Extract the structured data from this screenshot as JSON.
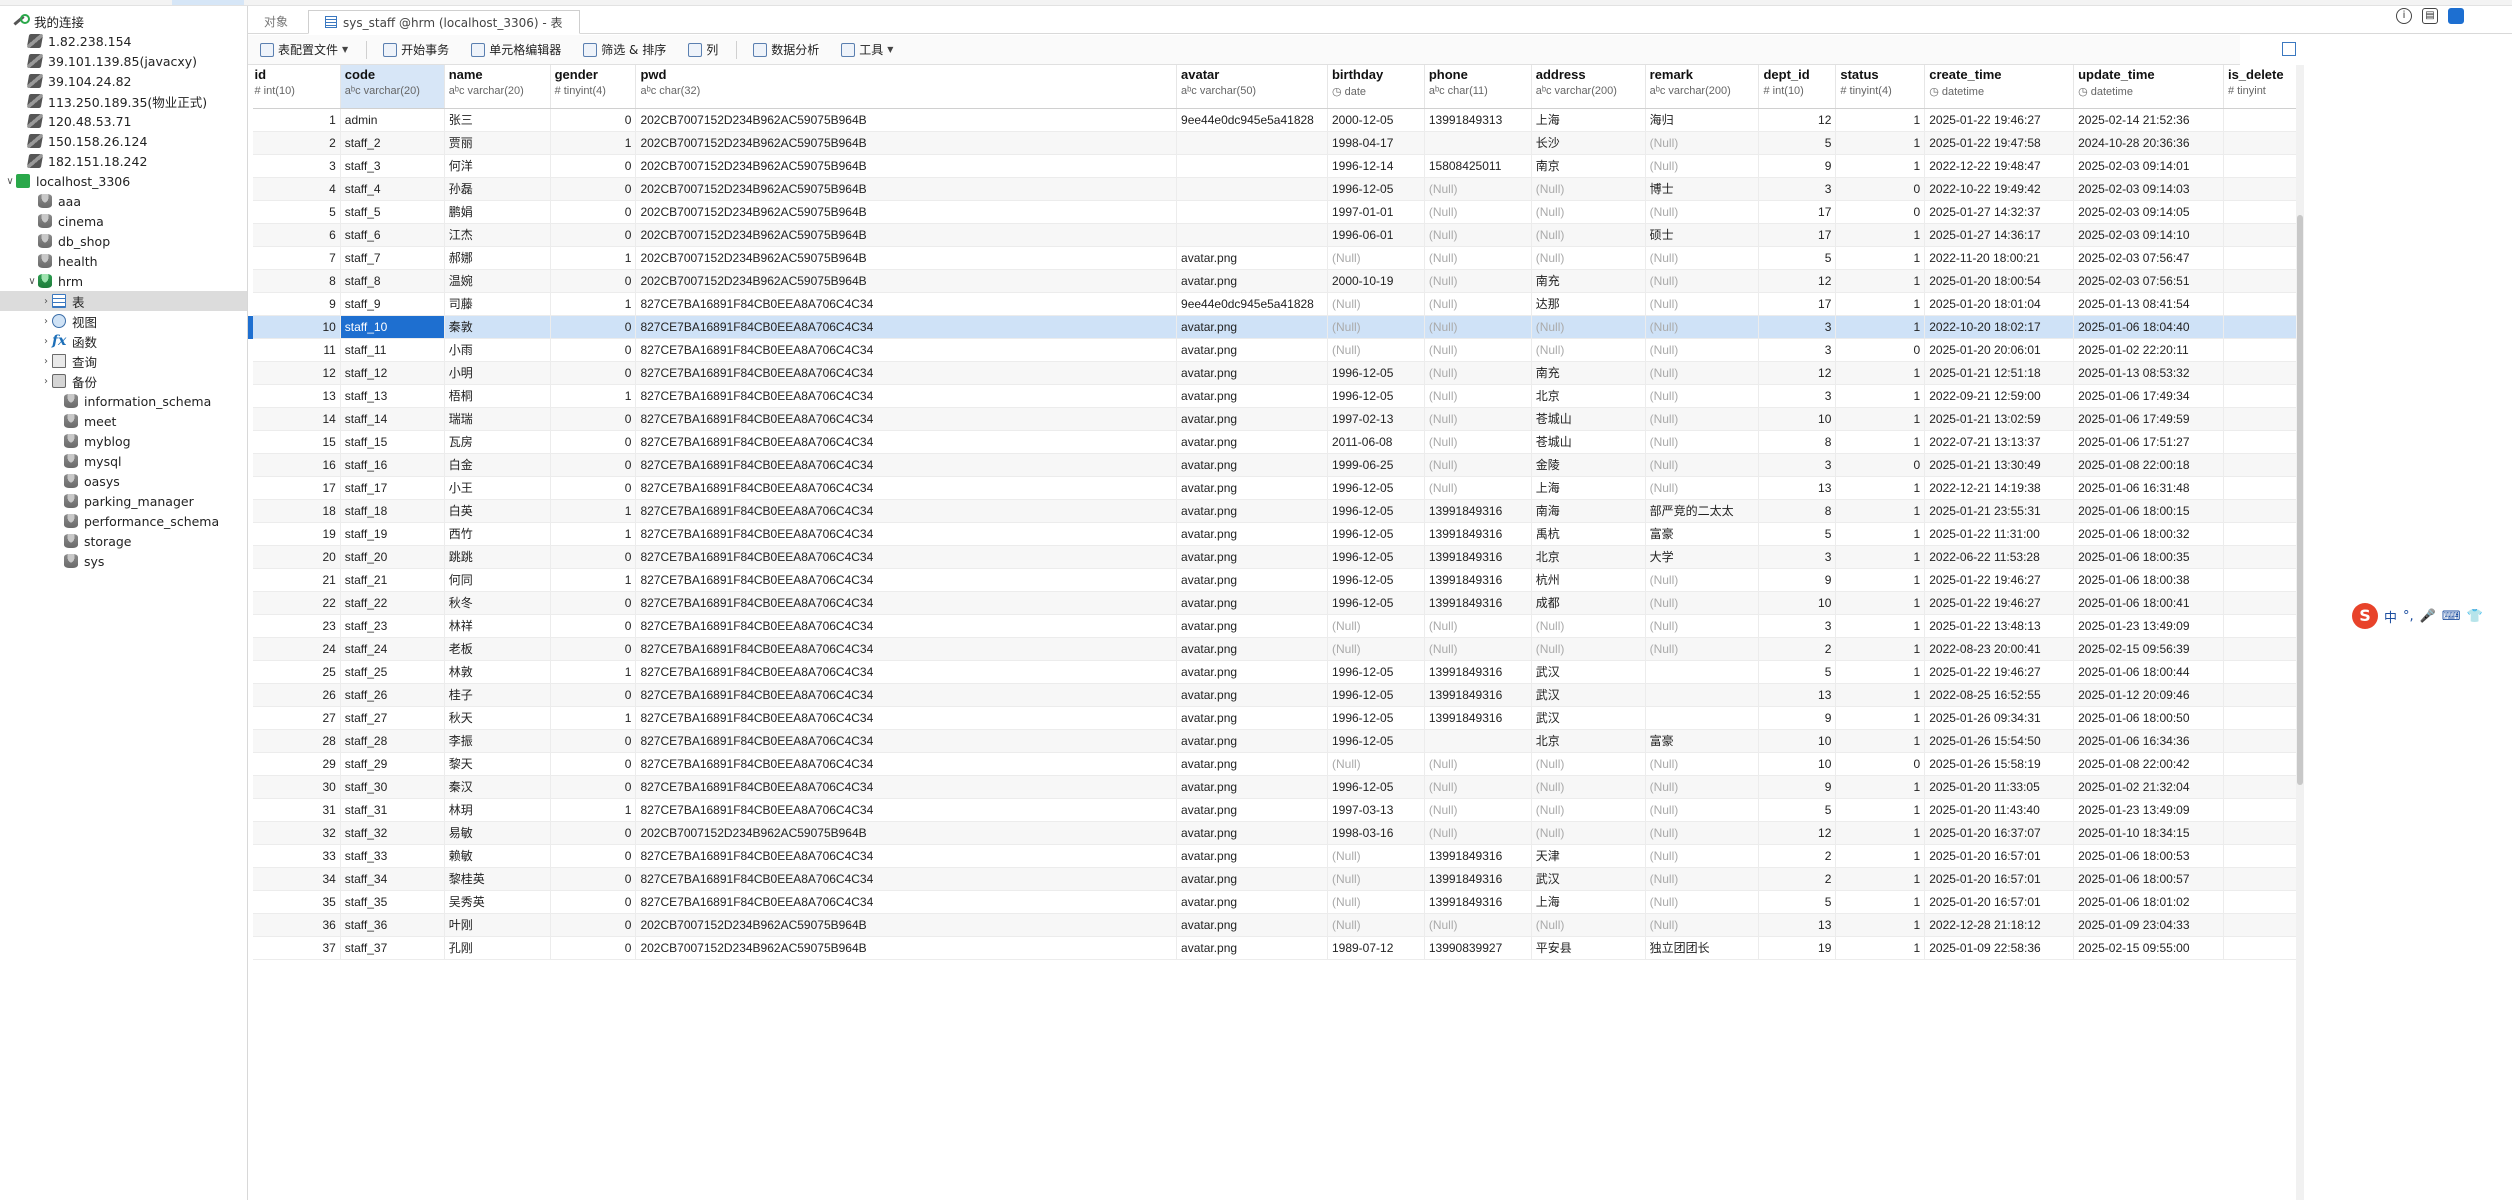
{
  "sidebar": {
    "root": "我的连接",
    "connections": [
      "1.82.238.154",
      "39.101.139.85(javacxy)",
      "39.104.24.82",
      "113.250.189.35(物业正式)",
      "120.48.53.71",
      "150.158.26.124",
      "182.151.18.242"
    ],
    "localhost": "localhost_3306",
    "dbs_before": [
      "aaa",
      "cinema",
      "db_shop",
      "health"
    ],
    "hrm": "hrm",
    "hrm_children": [
      {
        "label": "表",
        "icon": "table-icon",
        "selected": true
      },
      {
        "label": "视图",
        "icon": "view-icon"
      },
      {
        "label": "函数",
        "icon": "function-icon"
      },
      {
        "label": "查询",
        "icon": "query-icon"
      },
      {
        "label": "备份",
        "icon": "backup-icon"
      }
    ],
    "dbs_after": [
      "information_schema",
      "meet",
      "myblog",
      "mysql",
      "oasys",
      "parking_manager",
      "performance_schema",
      "storage",
      "sys"
    ]
  },
  "tabs": {
    "objects": "对象",
    "active": "sys_staff @hrm (localhost_3306) - 表"
  },
  "toolbar": {
    "config": "表配置文件",
    "begin_tx": "开始事务",
    "cell_editor": "单元格编辑器",
    "filter_sort": "筛选 & 排序",
    "columns": "列",
    "analysis": "数据分析",
    "tools": "工具"
  },
  "columns": [
    {
      "name": "id",
      "type": "int(10)",
      "icon": "#"
    },
    {
      "name": "code",
      "type": "varchar(20)",
      "icon": "aᵇc"
    },
    {
      "name": "name",
      "type": "varchar(20)",
      "icon": "aᵇc"
    },
    {
      "name": "gender",
      "type": "tinyint(4)",
      "icon": "#"
    },
    {
      "name": "pwd",
      "type": "char(32)",
      "icon": "aᵇc"
    },
    {
      "name": "avatar",
      "type": "varchar(50)",
      "icon": "aᵇc"
    },
    {
      "name": "birthday",
      "type": "date",
      "icon": "◷"
    },
    {
      "name": "phone",
      "type": "char(11)",
      "icon": "aᵇc"
    },
    {
      "name": "address",
      "type": "varchar(200)",
      "icon": "aᵇc"
    },
    {
      "name": "remark",
      "type": "varchar(200)",
      "icon": "aᵇc"
    },
    {
      "name": "dept_id",
      "type": "int(10)",
      "icon": "#"
    },
    {
      "name": "status",
      "type": "tinyint(4)",
      "icon": "#"
    },
    {
      "name": "create_time",
      "type": "datetime",
      "icon": "◷"
    },
    {
      "name": "update_time",
      "type": "datetime",
      "icon": "◷"
    },
    {
      "name": "is_delete",
      "type": "tinyint",
      "icon": "#"
    }
  ],
  "rows": [
    [
      "1",
      "admin",
      "张三",
      "0",
      "202CB7007152D234B962AC59075B964B",
      "9ee44e0dc945e5a41828",
      "2000-12-05",
      "13991849313",
      "上海",
      "海归",
      "12",
      "1",
      "2025-01-22 19:46:27",
      "2025-02-14 21:52:36"
    ],
    [
      "2",
      "staff_2",
      "贾丽",
      "1",
      "202CB7007152D234B962AC59075B964B",
      "",
      "1998-04-17",
      "",
      "长沙",
      "(Null)",
      "5",
      "1",
      "2025-01-22 19:47:58",
      "2024-10-28 20:36:36"
    ],
    [
      "3",
      "staff_3",
      "何洋",
      "0",
      "202CB7007152D234B962AC59075B964B",
      "",
      "1996-12-14",
      "15808425011",
      "南京",
      "(Null)",
      "9",
      "1",
      "2022-12-22 19:48:47",
      "2025-02-03 09:14:01"
    ],
    [
      "4",
      "staff_4",
      "孙磊",
      "0",
      "202CB7007152D234B962AC59075B964B",
      "",
      "1996-12-05",
      "(Null)",
      "(Null)",
      "博士",
      "3",
      "0",
      "2022-10-22 19:49:42",
      "2025-02-03 09:14:03"
    ],
    [
      "5",
      "staff_5",
      "鹏娟",
      "0",
      "202CB7007152D234B962AC59075B964B",
      "",
      "1997-01-01",
      "(Null)",
      "(Null)",
      "(Null)",
      "17",
      "0",
      "2025-01-27 14:32:37",
      "2025-02-03 09:14:05"
    ],
    [
      "6",
      "staff_6",
      "江杰",
      "0",
      "202CB7007152D234B962AC59075B964B",
      "",
      "1996-06-01",
      "(Null)",
      "(Null)",
      "硕士",
      "17",
      "1",
      "2025-01-27 14:36:17",
      "2025-02-03 09:14:10"
    ],
    [
      "7",
      "staff_7",
      "郝娜",
      "1",
      "202CB7007152D234B962AC59075B964B",
      "avatar.png",
      "(Null)",
      "(Null)",
      "(Null)",
      "(Null)",
      "5",
      "1",
      "2022-11-20 18:00:21",
      "2025-02-03 07:56:47"
    ],
    [
      "8",
      "staff_8",
      "温婉",
      "0",
      "202CB7007152D234B962AC59075B964B",
      "avatar.png",
      "2000-10-19",
      "(Null)",
      "南充",
      "(Null)",
      "12",
      "1",
      "2025-01-20 18:00:54",
      "2025-02-03 07:56:51"
    ],
    [
      "9",
      "staff_9",
      "司藤",
      "1",
      "827CE7BA16891F84CB0EEA8A706C4C34",
      "9ee44e0dc945e5a41828",
      "(Null)",
      "(Null)",
      "达那",
      "(Null)",
      "17",
      "1",
      "2025-01-20 18:01:04",
      "2025-01-13 08:41:54"
    ],
    [
      "10",
      "staff_10",
      "秦敦",
      "0",
      "827CE7BA16891F84CB0EEA8A706C4C34",
      "avatar.png",
      "(Null)",
      "(Null)",
      "(Null)",
      "(Null)",
      "3",
      "1",
      "2022-10-20 18:02:17",
      "2025-01-06 18:04:40"
    ],
    [
      "11",
      "staff_11",
      "小雨",
      "0",
      "827CE7BA16891F84CB0EEA8A706C4C34",
      "avatar.png",
      "(Null)",
      "(Null)",
      "(Null)",
      "(Null)",
      "3",
      "0",
      "2025-01-20 20:06:01",
      "2025-01-02 22:20:11"
    ],
    [
      "12",
      "staff_12",
      "小明",
      "0",
      "827CE7BA16891F84CB0EEA8A706C4C34",
      "avatar.png",
      "1996-12-05",
      "(Null)",
      "南充",
      "(Null)",
      "12",
      "1",
      "2025-01-21 12:51:18",
      "2025-01-13 08:53:32"
    ],
    [
      "13",
      "staff_13",
      "梧桐",
      "1",
      "827CE7BA16891F84CB0EEA8A706C4C34",
      "avatar.png",
      "1996-12-05",
      "(Null)",
      "北京",
      "(Null)",
      "3",
      "1",
      "2022-09-21 12:59:00",
      "2025-01-06 17:49:34"
    ],
    [
      "14",
      "staff_14",
      "瑞瑞",
      "0",
      "827CE7BA16891F84CB0EEA8A706C4C34",
      "avatar.png",
      "1997-02-13",
      "(Null)",
      "苍城山",
      "(Null)",
      "10",
      "1",
      "2025-01-21 13:02:59",
      "2025-01-06 17:49:59"
    ],
    [
      "15",
      "staff_15",
      "瓦房",
      "0",
      "827CE7BA16891F84CB0EEA8A706C4C34",
      "avatar.png",
      "2011-06-08",
      "(Null)",
      "苍城山",
      "(Null)",
      "8",
      "1",
      "2022-07-21 13:13:37",
      "2025-01-06 17:51:27"
    ],
    [
      "16",
      "staff_16",
      "白金",
      "0",
      "827CE7BA16891F84CB0EEA8A706C4C34",
      "avatar.png",
      "1999-06-25",
      "(Null)",
      "金陵",
      "(Null)",
      "3",
      "0",
      "2025-01-21 13:30:49",
      "2025-01-08 22:00:18"
    ],
    [
      "17",
      "staff_17",
      "小王",
      "0",
      "827CE7BA16891F84CB0EEA8A706C4C34",
      "avatar.png",
      "1996-12-05",
      "(Null)",
      "上海",
      "(Null)",
      "13",
      "1",
      "2022-12-21 14:19:38",
      "2025-01-06 16:31:48"
    ],
    [
      "18",
      "staff_18",
      "白英",
      "1",
      "827CE7BA16891F84CB0EEA8A706C4C34",
      "avatar.png",
      "1996-12-05",
      "13991849316",
      "南海",
      "部严竞的二太太",
      "8",
      "1",
      "2025-01-21 23:55:31",
      "2025-01-06 18:00:15"
    ],
    [
      "19",
      "staff_19",
      "西竹",
      "1",
      "827CE7BA16891F84CB0EEA8A706C4C34",
      "avatar.png",
      "1996-12-05",
      "13991849316",
      "禹杭",
      "富豪",
      "5",
      "1",
      "2025-01-22 11:31:00",
      "2025-01-06 18:00:32"
    ],
    [
      "20",
      "staff_20",
      "跳跳",
      "0",
      "827CE7BA16891F84CB0EEA8A706C4C34",
      "avatar.png",
      "1996-12-05",
      "13991849316",
      "北京",
      "大学",
      "3",
      "1",
      "2022-06-22 11:53:28",
      "2025-01-06 18:00:35"
    ],
    [
      "21",
      "staff_21",
      "何同",
      "1",
      "827CE7BA16891F84CB0EEA8A706C4C34",
      "avatar.png",
      "1996-12-05",
      "13991849316",
      "杭州",
      "(Null)",
      "9",
      "1",
      "2025-01-22 19:46:27",
      "2025-01-06 18:00:38"
    ],
    [
      "22",
      "staff_22",
      "秋冬",
      "0",
      "827CE7BA16891F84CB0EEA8A706C4C34",
      "avatar.png",
      "1996-12-05",
      "13991849316",
      "成都",
      "(Null)",
      "10",
      "1",
      "2025-01-22 19:46:27",
      "2025-01-06 18:00:41"
    ],
    [
      "23",
      "staff_23",
      "林祥",
      "0",
      "827CE7BA16891F84CB0EEA8A706C4C34",
      "avatar.png",
      "(Null)",
      "(Null)",
      "(Null)",
      "(Null)",
      "3",
      "1",
      "2025-01-22 13:48:13",
      "2025-01-23 13:49:09"
    ],
    [
      "24",
      "staff_24",
      "老板",
      "0",
      "827CE7BA16891F84CB0EEA8A706C4C34",
      "avatar.png",
      "(Null)",
      "(Null)",
      "(Null)",
      "(Null)",
      "2",
      "1",
      "2022-08-23 20:00:41",
      "2025-02-15 09:56:39"
    ],
    [
      "25",
      "staff_25",
      "林敦",
      "1",
      "827CE7BA16891F84CB0EEA8A706C4C34",
      "avatar.png",
      "1996-12-05",
      "13991849316",
      "武汉",
      "",
      "5",
      "1",
      "2025-01-22 19:46:27",
      "2025-01-06 18:00:44"
    ],
    [
      "26",
      "staff_26",
      "桂子",
      "0",
      "827CE7BA16891F84CB0EEA8A706C4C34",
      "avatar.png",
      "1996-12-05",
      "13991849316",
      "武汉",
      "",
      "13",
      "1",
      "2022-08-25 16:52:55",
      "2025-01-12 20:09:46"
    ],
    [
      "27",
      "staff_27",
      "秋天",
      "1",
      "827CE7BA16891F84CB0EEA8A706C4C34",
      "avatar.png",
      "1996-12-05",
      "13991849316",
      "武汉",
      "",
      "9",
      "1",
      "2025-01-26 09:34:31",
      "2025-01-06 18:00:50"
    ],
    [
      "28",
      "staff_28",
      "李振",
      "0",
      "827CE7BA16891F84CB0EEA8A706C4C34",
      "avatar.png",
      "1996-12-05",
      "",
      "北京",
      "富豪",
      "10",
      "1",
      "2025-01-26 15:54:50",
      "2025-01-06 16:34:36"
    ],
    [
      "29",
      "staff_29",
      "黎天",
      "0",
      "827CE7BA16891F84CB0EEA8A706C4C34",
      "avatar.png",
      "(Null)",
      "(Null)",
      "(Null)",
      "(Null)",
      "10",
      "0",
      "2025-01-26 15:58:19",
      "2025-01-08 22:00:42"
    ],
    [
      "30",
      "staff_30",
      "秦汉",
      "0",
      "827CE7BA16891F84CB0EEA8A706C4C34",
      "avatar.png",
      "1996-12-05",
      "(Null)",
      "(Null)",
      "(Null)",
      "9",
      "1",
      "2025-01-20 11:33:05",
      "2025-01-02 21:32:04"
    ],
    [
      "31",
      "staff_31",
      "林玥",
      "1",
      "827CE7BA16891F84CB0EEA8A706C4C34",
      "avatar.png",
      "1997-03-13",
      "(Null)",
      "(Null)",
      "(Null)",
      "5",
      "1",
      "2025-01-20 11:43:40",
      "2025-01-23 13:49:09"
    ],
    [
      "32",
      "staff_32",
      "易敏",
      "0",
      "202CB7007152D234B962AC59075B964B",
      "avatar.png",
      "1998-03-16",
      "(Null)",
      "(Null)",
      "(Null)",
      "12",
      "1",
      "2025-01-20 16:37:07",
      "2025-01-10 18:34:15"
    ],
    [
      "33",
      "staff_33",
      "赖敏",
      "0",
      "827CE7BA16891F84CB0EEA8A706C4C34",
      "avatar.png",
      "(Null)",
      "13991849316",
      "天津",
      "(Null)",
      "2",
      "1",
      "2025-01-20 16:57:01",
      "2025-01-06 18:00:53"
    ],
    [
      "34",
      "staff_34",
      "黎桂英",
      "0",
      "827CE7BA16891F84CB0EEA8A706C4C34",
      "avatar.png",
      "(Null)",
      "13991849316",
      "武汉",
      "(Null)",
      "2",
      "1",
      "2025-01-20 16:57:01",
      "2025-01-06 18:00:57"
    ],
    [
      "35",
      "staff_35",
      "吴秀英",
      "0",
      "827CE7BA16891F84CB0EEA8A706C4C34",
      "avatar.png",
      "(Null)",
      "13991849316",
      "上海",
      "(Null)",
      "5",
      "1",
      "2025-01-20 16:57:01",
      "2025-01-06 18:01:02"
    ],
    [
      "36",
      "staff_36",
      "叶刚",
      "0",
      "202CB7007152D234B962AC59075B964B",
      "avatar.png",
      "(Null)",
      "(Null)",
      "(Null)",
      "(Null)",
      "13",
      "1",
      "2022-12-28 21:18:12",
      "2025-01-09 23:04:33"
    ],
    [
      "37",
      "staff_37",
      "孔刚",
      "0",
      "202CB7007152D234B962AC59075B964B",
      "avatar.png",
      "1989-07-12",
      "13990839927",
      "平安县",
      "独立团团长",
      "19",
      "1",
      "2025-01-09 22:58:36",
      "2025-02-15 09:55:00"
    ]
  ],
  "selected_row": 10,
  "ime": {
    "logo": "S",
    "items": [
      "中",
      "°,",
      "🎤",
      "⌨",
      "👕"
    ]
  }
}
